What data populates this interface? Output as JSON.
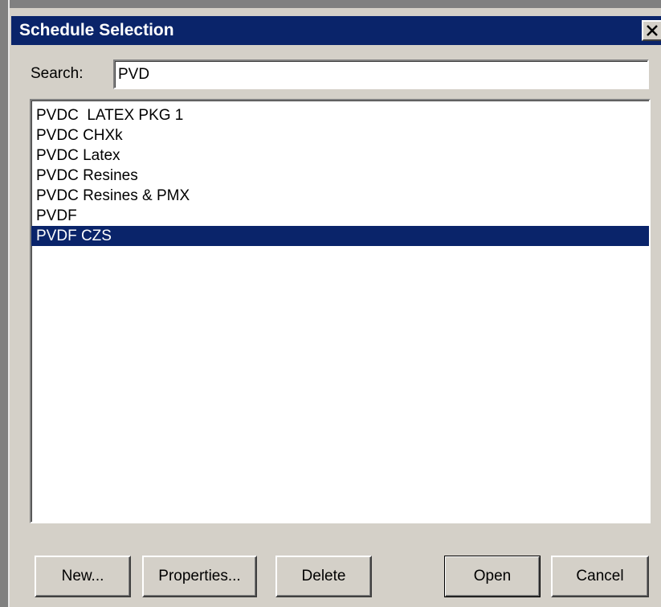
{
  "dialog": {
    "title": "Schedule Selection",
    "close_icon": "close-x-icon"
  },
  "search": {
    "label": "Search:",
    "value": "PVD"
  },
  "list": {
    "items": [
      {
        "label": "PVDC  LATEX PKG 1",
        "selected": false
      },
      {
        "label": "PVDC CHXk",
        "selected": false
      },
      {
        "label": "PVDC Latex",
        "selected": false
      },
      {
        "label": "PVDC Resines",
        "selected": false
      },
      {
        "label": "PVDC Resines & PMX",
        "selected": false
      },
      {
        "label": "PVDF",
        "selected": false
      },
      {
        "label": "PVDF CZS",
        "selected": true
      }
    ]
  },
  "buttons": {
    "new": "New...",
    "properties": "Properties...",
    "delete": "Delete",
    "open": "Open",
    "cancel": "Cancel"
  },
  "colors": {
    "titlebar": "#0a246a",
    "selection": "#0a246a",
    "face": "#d4d0c8"
  }
}
